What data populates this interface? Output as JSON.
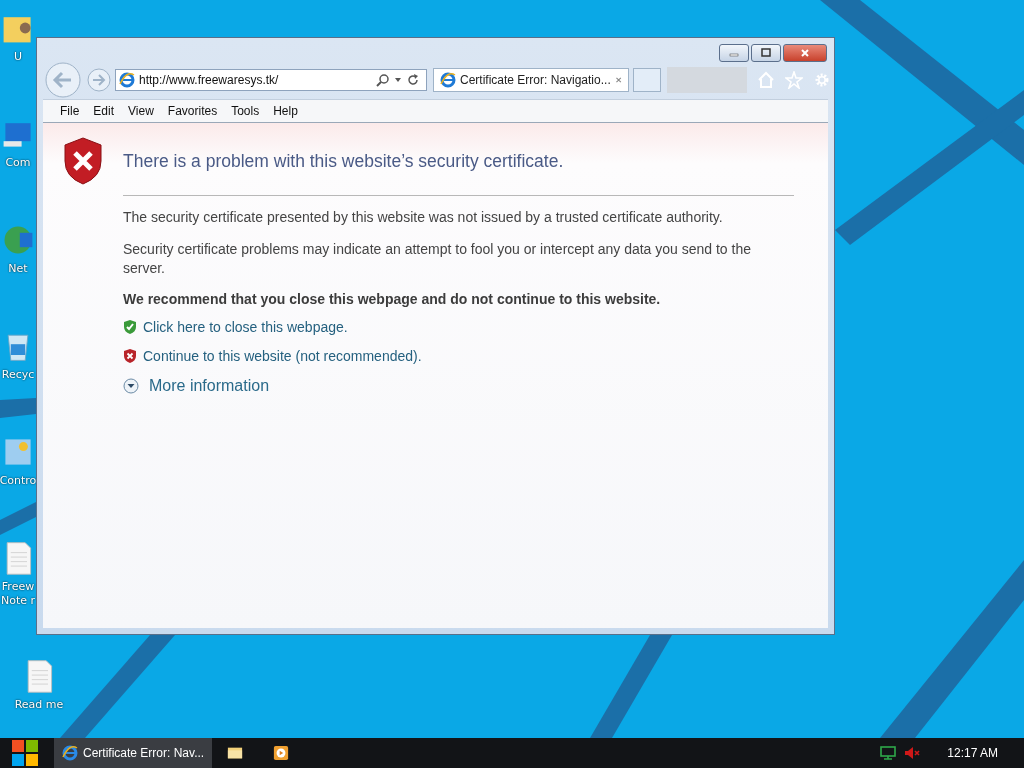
{
  "desktop_icons": [
    {
      "kind": "user-folder",
      "lines": [
        "U"
      ]
    },
    {
      "kind": "computer",
      "lines": [
        "Com"
      ]
    },
    {
      "kind": "network",
      "lines": [
        "Net"
      ]
    },
    {
      "kind": "recycle",
      "lines": [
        "Recyc"
      ]
    },
    {
      "kind": "control",
      "lines": [
        "Contro"
      ]
    },
    {
      "kind": "document",
      "lines": [
        "Freew",
        "Note r"
      ]
    },
    {
      "kind": "document",
      "lines": [
        "Read me"
      ]
    }
  ],
  "browser": {
    "address": "http://www.freewaresys.tk/",
    "tabs": [
      {
        "title": "Certificate Error: Navigatio...",
        "selected": true
      }
    ],
    "menu": [
      "File",
      "Edit",
      "View",
      "Favorites",
      "Tools",
      "Help"
    ],
    "page": {
      "heading": "There is a problem with this website’s security certificate.",
      "paragraphs": [
        "The security certificate presented by this website was not issued by a trusted certificate authority.",
        "Security certificate problems may indicate an attempt to fool you or intercept any data you send to the server."
      ],
      "recommendation": "We recommend that you close this webpage and do not continue to this website.",
      "links": [
        {
          "kind": "safe",
          "text": "Click here to close this webpage."
        },
        {
          "kind": "unsafe",
          "text": "Continue to this website (not recommended)."
        }
      ],
      "more": {
        "label": "More information",
        "expanded": false
      }
    }
  },
  "taskbar": {
    "items": [
      {
        "kind": "browser",
        "label": "Certificate Error: Nav...",
        "selected": true
      },
      {
        "kind": "folder",
        "selected": false
      },
      {
        "kind": "media",
        "selected": false
      }
    ],
    "tray": [
      {
        "kind": "network"
      },
      {
        "kind": "volume",
        "muted": true
      }
    ],
    "clock": "12:17 AM"
  }
}
